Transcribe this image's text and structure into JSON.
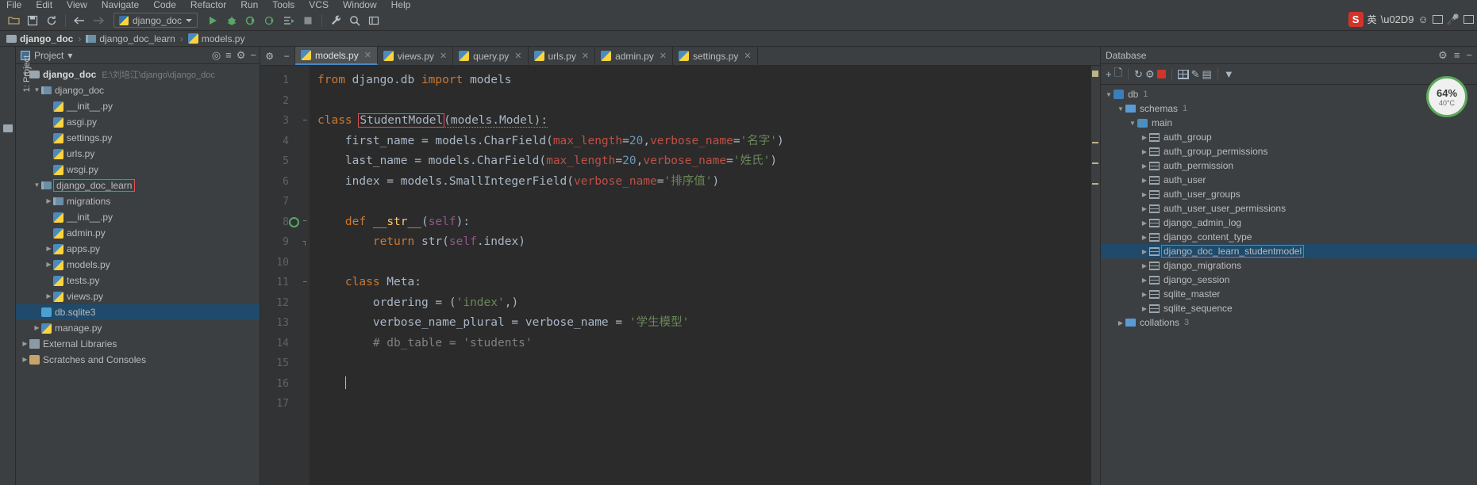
{
  "app": {
    "menu": [
      "File",
      "Edit",
      "View",
      "Navigate",
      "Code",
      "Refactor",
      "Run",
      "Tools",
      "VCS",
      "Window",
      "Help"
    ]
  },
  "toolbar": {
    "icons": [
      "open-folder-icon",
      "save-icon",
      "sync-icon",
      "back-arrow-icon",
      "forward-arrow-icon"
    ],
    "run_config": "django_doc",
    "run_icons": [
      "run-icon",
      "debug-icon",
      "run-coverage-icon",
      "profile-icon",
      "run-with-console-icon",
      "stop-icon",
      "wrench-icon",
      "search-icon",
      "toggle-icon"
    ]
  },
  "tray": {
    "sogou_badge": "S",
    "lang": "英",
    "items": [
      "sogou-icon",
      "lang-label",
      "comma-icon",
      "emoji-icon",
      "image-icon",
      "mic-icon",
      "keyboard-icon"
    ]
  },
  "breadcrumb": {
    "items": [
      {
        "label": "django_doc",
        "icon": "folder-icon"
      },
      {
        "label": "django_doc_learn",
        "icon": "module-icon"
      },
      {
        "label": "models.py",
        "icon": "python-file-icon"
      }
    ],
    "separator": "›"
  },
  "project_panel": {
    "side_label": "1: Project",
    "title": "Project",
    "dropdown": "▾",
    "header_icons": [
      "locate-icon",
      "collapse-all-icon",
      "settings-icon",
      "hide-icon"
    ],
    "tree": [
      {
        "label": "django_doc",
        "path": "E:\\刘培江\\django\\django_doc",
        "arrow": "▼",
        "icon": "folder-icon",
        "indent": 0,
        "bold": true
      },
      {
        "label": "django_doc",
        "arrow": "▼",
        "icon": "module-icon",
        "indent": 1
      },
      {
        "label": "__init__.py",
        "arrow": "",
        "icon": "python-file-icon",
        "indent": 2
      },
      {
        "label": "asgi.py",
        "arrow": "",
        "icon": "python-file-icon",
        "indent": 2
      },
      {
        "label": "settings.py",
        "arrow": "",
        "icon": "python-file-icon",
        "indent": 2
      },
      {
        "label": "urls.py",
        "arrow": "",
        "icon": "python-file-icon",
        "indent": 2
      },
      {
        "label": "wsgi.py",
        "arrow": "",
        "icon": "python-file-icon",
        "indent": 2
      },
      {
        "label": "django_doc_learn",
        "arrow": "▼",
        "icon": "module-icon",
        "indent": 1,
        "highlight": true
      },
      {
        "label": "migrations",
        "arrow": "▶",
        "icon": "module-icon",
        "indent": 2
      },
      {
        "label": "__init__.py",
        "arrow": "",
        "icon": "python-file-icon",
        "indent": 2
      },
      {
        "label": "admin.py",
        "arrow": "",
        "icon": "python-file-icon",
        "indent": 2
      },
      {
        "label": "apps.py",
        "arrow": "▶",
        "icon": "python-file-icon",
        "indent": 2
      },
      {
        "label": "models.py",
        "arrow": "▶",
        "icon": "python-file-icon",
        "indent": 2
      },
      {
        "label": "tests.py",
        "arrow": "",
        "icon": "python-file-icon",
        "indent": 2
      },
      {
        "label": "views.py",
        "arrow": "▶",
        "icon": "python-file-icon",
        "indent": 2
      },
      {
        "label": "db.sqlite3",
        "arrow": "",
        "icon": "sqlite-db-icon",
        "indent": 1,
        "selected": true
      },
      {
        "label": "manage.py",
        "arrow": "▶",
        "icon": "python-file-icon",
        "indent": 1
      },
      {
        "label": "External Libraries",
        "arrow": "▶",
        "icon": "library-icon",
        "indent": 0
      },
      {
        "label": "Scratches and Consoles",
        "arrow": "▶",
        "icon": "scratches-icon",
        "indent": 0
      }
    ]
  },
  "editor": {
    "tabs": [
      {
        "label": "models.py",
        "active": true
      },
      {
        "label": "views.py",
        "active": false
      },
      {
        "label": "query.py",
        "active": false
      },
      {
        "label": "urls.py",
        "active": false
      },
      {
        "label": "admin.py",
        "active": false
      },
      {
        "label": "settings.py",
        "active": false
      }
    ],
    "gutter_icons": [
      "settings-icon",
      "minimize-icon"
    ],
    "line_numbers": [
      "1",
      "2",
      "3",
      "4",
      "5",
      "6",
      "7",
      "8",
      "9",
      "10",
      "11",
      "12",
      "13",
      "14",
      "15",
      "16",
      "17"
    ],
    "code_lines": [
      "from django.db import models",
      "",
      "class StudentModel(models.Model):",
      "    first_name = models.CharField(max_length=20,verbose_name='名字')",
      "    last_name = models.CharField(max_length=20,verbose_name='姓氏')",
      "    index = models.SmallIntegerField(verbose_name='排序值')",
      "",
      "    def __str__(self):",
      "        return str(self.index)",
      "",
      "    class Meta:",
      "        ordering = ('index',)",
      "        verbose_name_plural = verbose_name = '学生模型'",
      "        # db_table = 'students'",
      "",
      "",
      ""
    ],
    "cursor_line": 16
  },
  "database_panel": {
    "title": "Database",
    "header_icons": [
      "settings-icon",
      "collapse-icon",
      "hide-icon"
    ],
    "tool_icons": [
      "add-icon",
      "copy-icon",
      "refresh-icon",
      "run-query-icon",
      "stop-icon",
      "table-icon",
      "edit-icon",
      "console-icon",
      "filter-icon"
    ],
    "tree": [
      {
        "label": "db",
        "count": "1",
        "arrow": "▼",
        "icon": "database-icon",
        "indent": 0
      },
      {
        "label": "schemas",
        "count": "1",
        "arrow": "▼",
        "icon": "folder-icon",
        "indent": 1
      },
      {
        "label": "main",
        "count": "",
        "arrow": "▼",
        "icon": "schema-icon",
        "indent": 2
      },
      {
        "label": "auth_group",
        "count": "",
        "arrow": "▶",
        "icon": "table-icon",
        "indent": 3
      },
      {
        "label": "auth_group_permissions",
        "count": "",
        "arrow": "▶",
        "icon": "table-icon",
        "indent": 3
      },
      {
        "label": "auth_permission",
        "count": "",
        "arrow": "▶",
        "icon": "table-icon",
        "indent": 3
      },
      {
        "label": "auth_user",
        "count": "",
        "arrow": "▶",
        "icon": "table-icon",
        "indent": 3
      },
      {
        "label": "auth_user_groups",
        "count": "",
        "arrow": "▶",
        "icon": "table-icon",
        "indent": 3
      },
      {
        "label": "auth_user_user_permissions",
        "count": "",
        "arrow": "▶",
        "icon": "table-icon",
        "indent": 3
      },
      {
        "label": "django_admin_log",
        "count": "",
        "arrow": "▶",
        "icon": "table-icon",
        "indent": 3
      },
      {
        "label": "django_content_type",
        "count": "",
        "arrow": "▶",
        "icon": "table-icon",
        "indent": 3
      },
      {
        "label": "django_doc_learn_studentmodel",
        "count": "",
        "arrow": "▶",
        "icon": "table-icon",
        "indent": 3,
        "selected": true,
        "highlight": true
      },
      {
        "label": "django_migrations",
        "count": "",
        "arrow": "▶",
        "icon": "table-icon",
        "indent": 3
      },
      {
        "label": "django_session",
        "count": "",
        "arrow": "▶",
        "icon": "table-icon",
        "indent": 3
      },
      {
        "label": "sqlite_master",
        "count": "",
        "arrow": "▶",
        "icon": "table-icon",
        "indent": 3
      },
      {
        "label": "sqlite_sequence",
        "count": "",
        "arrow": "▶",
        "icon": "table-icon",
        "indent": 3
      },
      {
        "label": "collations",
        "count": "3",
        "arrow": "▶",
        "icon": "folder-icon",
        "indent": 1
      }
    ]
  },
  "gauge": {
    "value": "64%",
    "temp": "40°C"
  },
  "colors": {
    "accent": "#4a88c7",
    "selection": "#1f4a6b",
    "highlight_box": "#e05252",
    "background": "#3c3f41",
    "editor_bg": "#2b2b2b"
  }
}
